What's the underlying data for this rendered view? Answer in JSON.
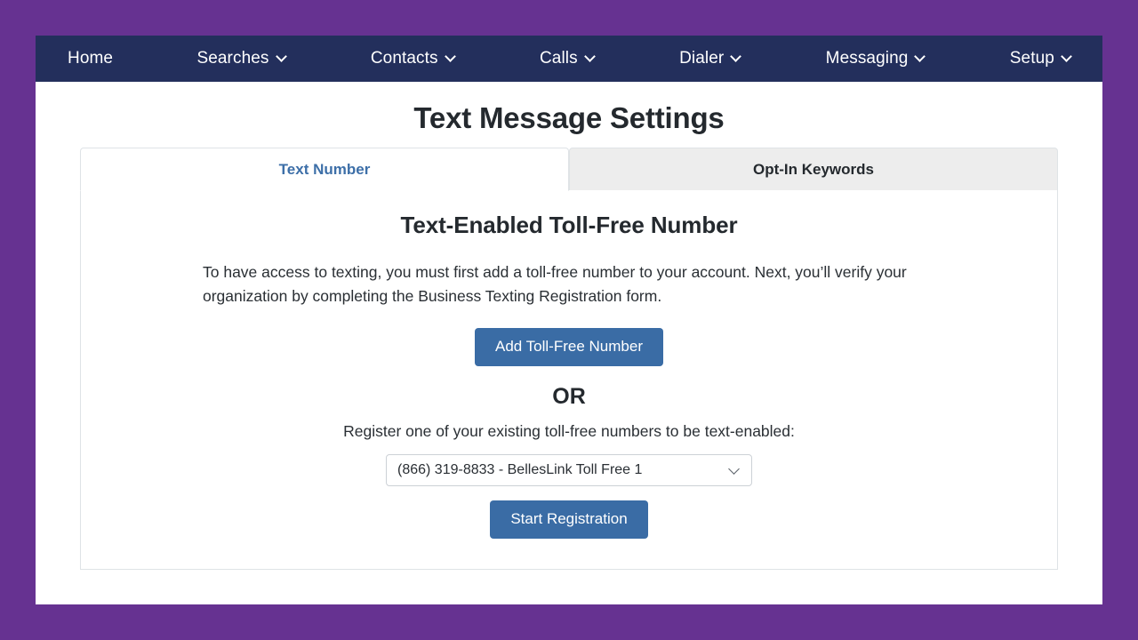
{
  "theme": {
    "frame_purple": "#663291",
    "nav_navy": "#232f5c",
    "button_blue": "#3a6ca5",
    "active_tab_text": "#3d6fa8",
    "inactive_tab_bg": "#ededed"
  },
  "nav": {
    "items": [
      {
        "label": "Home",
        "has_caret": false
      },
      {
        "label": "Searches",
        "has_caret": true
      },
      {
        "label": "Contacts",
        "has_caret": true
      },
      {
        "label": "Calls",
        "has_caret": true
      },
      {
        "label": "Dialer",
        "has_caret": true
      },
      {
        "label": "Messaging",
        "has_caret": true
      },
      {
        "label": "Setup",
        "has_caret": true
      }
    ]
  },
  "page": {
    "title": "Text Message Settings"
  },
  "tabs": [
    {
      "label": "Text Number",
      "active": true
    },
    {
      "label": "Opt-In Keywords",
      "active": false
    }
  ],
  "panel": {
    "heading": "Text-Enabled Toll-Free Number",
    "intro": "To have access to texting, you must first add a toll-free number to your account. Next, you’ll verify your organization by completing the Business Texting Registration form.",
    "add_button": "Add Toll-Free Number",
    "or_label": "OR",
    "register_label": "Register one of your existing toll-free numbers to be text-enabled:",
    "number_select": {
      "selected": "(866) 319-8833 - BellesLink Toll Free 1",
      "options": [
        "(866) 319-8833 - BellesLink Toll Free 1"
      ]
    },
    "start_button": "Start Registration"
  }
}
